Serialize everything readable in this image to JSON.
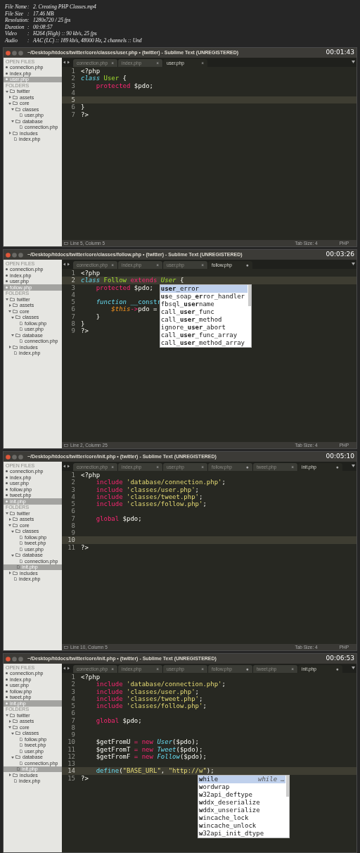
{
  "header": {
    "fields": [
      {
        "label": "File Name",
        "separator": ":",
        "value": "2. Creating PHP Classes.mp4"
      },
      {
        "label": "File Size",
        "separator": ":",
        "value": "17.46 MB"
      },
      {
        "label": "Resolution",
        "separator": ":",
        "value": "1280x720 / 25 fps"
      },
      {
        "label": "Duration",
        "separator": ":",
        "value": "00:08:57"
      },
      {
        "label": "Video",
        "separator": ":",
        "value": "H264 (High) :: 90 kb/s, 25 fps"
      },
      {
        "label": "Audio",
        "separator": ":",
        "value": "AAC (LC) :: 189 kb/s, 48000 Hz, 2 channels :: Und"
      }
    ]
  },
  "frames": [
    {
      "title": "~/Desktop/htdocs/twitter/core/classes/user.php • (twitter) - Sublime Text (UNREGISTERED)",
      "time": "00:01:43",
      "sidebar": {
        "open_files_heading": "OPEN FILES",
        "folders_heading": "FOLDERS",
        "open_files": [
          {
            "name": "connection.php",
            "selected": false
          },
          {
            "name": "index.php",
            "selected": false
          },
          {
            "name": "user.php",
            "selected": true
          }
        ],
        "folders": [
          {
            "name": "twitter",
            "kind": "folder",
            "expanded": true,
            "selected": false,
            "children": [
              {
                "name": "assets",
                "kind": "folder",
                "expanded": false,
                "selected": false
              },
              {
                "name": "core",
                "kind": "folder",
                "expanded": true,
                "selected": false,
                "children": [
                  {
                    "name": "classes",
                    "kind": "folder",
                    "expanded": true,
                    "selected": false,
                    "children": [
                      {
                        "name": "user.php",
                        "kind": "file",
                        "selected": false
                      }
                    ]
                  },
                  {
                    "name": "database",
                    "kind": "folder",
                    "expanded": true,
                    "selected": false,
                    "children": [
                      {
                        "name": "connection.php",
                        "kind": "file",
                        "selected": false
                      }
                    ]
                  }
                ]
              },
              {
                "name": "includes",
                "kind": "folder",
                "expanded": false,
                "selected": false
              },
              {
                "name": "index.php",
                "kind": "file",
                "selected": false
              }
            ]
          }
        ]
      },
      "tabs": [
        {
          "label": "connection.php",
          "close_mark": "×",
          "selected": false
        },
        {
          "label": "index.php",
          "close_mark": "×",
          "selected": false
        },
        {
          "label": "user.php",
          "close_mark": "×",
          "selected": true
        }
      ],
      "lines": [
        {
          "number": "1",
          "current": false,
          "tokens": [
            {
              "kind": "plain",
              "text": "<?php"
            }
          ]
        },
        {
          "number": "2",
          "current": false,
          "tokens": [
            {
              "kind": "storage",
              "text": "class"
            },
            {
              "kind": "class",
              "text": " User"
            },
            {
              "kind": "plain",
              "text": " {"
            }
          ]
        },
        {
          "number": "3",
          "current": false,
          "tokens": [
            {
              "kind": "keyword",
              "text": "    protected"
            },
            {
              "kind": "plain",
              "text": " $pdo;"
            }
          ]
        },
        {
          "number": "4",
          "current": false
        },
        {
          "number": "5",
          "current": true
        },
        {
          "number": "6",
          "current": false,
          "tokens": [
            {
              "kind": "plain",
              "text": "}"
            }
          ]
        },
        {
          "number": "7",
          "current": false,
          "tokens": [
            {
              "kind": "plain",
              "text": "?>"
            }
          ]
        }
      ],
      "status": {
        "position": "Line 5, Column 5",
        "tab_size": "Tab Size: 4",
        "syntax": "PHP"
      }
    },
    {
      "title": "~/Desktop/htdocs/twitter/core/classes/follow.php • (twitter) - Sublime Text (UNREGISTERED)",
      "time": "00:03:26",
      "sidebar": {
        "open_files_heading": "OPEN FILES",
        "folders_heading": "FOLDERS",
        "open_files": [
          {
            "name": "connection.php",
            "selected": false
          },
          {
            "name": "index.php",
            "selected": false
          },
          {
            "name": "user.php",
            "selected": false
          },
          {
            "name": "follow.php",
            "selected": true
          }
        ],
        "folders": [
          {
            "name": "twitter",
            "kind": "folder",
            "expanded": true,
            "selected": false,
            "children": [
              {
                "name": "assets",
                "kind": "folder",
                "expanded": false,
                "selected": false
              },
              {
                "name": "core",
                "kind": "folder",
                "expanded": true,
                "selected": false,
                "children": [
                  {
                    "name": "classes",
                    "kind": "folder",
                    "expanded": true,
                    "selected": false,
                    "children": [
                      {
                        "name": "follow.php",
                        "kind": "file",
                        "selected": false
                      },
                      {
                        "name": "user.php",
                        "kind": "file",
                        "selected": false
                      }
                    ]
                  },
                  {
                    "name": "database",
                    "kind": "folder",
                    "expanded": true,
                    "selected": false,
                    "children": [
                      {
                        "name": "connection.php",
                        "kind": "file",
                        "selected": false
                      }
                    ]
                  }
                ]
              },
              {
                "name": "includes",
                "kind": "folder",
                "expanded": false,
                "selected": false
              },
              {
                "name": "index.php",
                "kind": "file",
                "selected": false
              }
            ]
          }
        ]
      },
      "tabs": [
        {
          "label": "connection.php",
          "close_mark": "×",
          "selected": false
        },
        {
          "label": "index.php",
          "close_mark": "×",
          "selected": false
        },
        {
          "label": "user.php",
          "close_mark": "×",
          "selected": false
        },
        {
          "label": "follow.php",
          "close_mark": "●",
          "selected": true
        }
      ],
      "lines": [
        {
          "number": "1",
          "current": false,
          "tokens": [
            {
              "kind": "plain",
              "text": "<?php"
            }
          ]
        },
        {
          "number": "2",
          "current": true,
          "tokens": [
            {
              "kind": "storage",
              "text": "class"
            },
            {
              "kind": "class",
              "text": " Follow"
            },
            {
              "kind": "keyword",
              "text": " extends "
            },
            {
              "kind": "inherited",
              "text": "User",
              "completing": true
            },
            {
              "kind": "plain",
              "text": " {"
            }
          ]
        },
        {
          "number": "3",
          "current": false,
          "tokens": [
            {
              "kind": "keyword",
              "text": "    protected"
            },
            {
              "kind": "plain",
              "text": " $pdo;"
            }
          ]
        },
        {
          "number": "4",
          "current": false
        },
        {
          "number": "5",
          "current": false,
          "tokens": [
            {
              "kind": "storage",
              "text": "    function"
            },
            {
              "kind": "func",
              "text": " __constr"
            }
          ]
        },
        {
          "number": "6",
          "current": false,
          "tokens": [
            {
              "kind": "variable",
              "text": "        $this"
            },
            {
              "kind": "keyword",
              "text": "->"
            },
            {
              "kind": "plain",
              "text": "pdo ="
            }
          ]
        },
        {
          "number": "7",
          "current": false,
          "tokens": [
            {
              "kind": "plain",
              "text": "    }"
            }
          ]
        },
        {
          "number": "8",
          "current": false,
          "tokens": [
            {
              "kind": "plain",
              "text": "}"
            }
          ]
        },
        {
          "number": "9",
          "current": false,
          "tokens": [
            {
              "kind": "plain",
              "text": "?>"
            }
          ]
        }
      ],
      "autocomplete": {
        "items": [
          {
            "text": "**user**_error",
            "selected": true
          },
          {
            "text": "**us**e_soap_**er**ror_handler",
            "selected": false
          },
          {
            "text": "fbsql_**user**name",
            "selected": false
          },
          {
            "text": "call_**user**_func",
            "selected": false
          },
          {
            "text": "call_**user**_method",
            "selected": false
          },
          {
            "text": "ignore_**user**_abort",
            "selected": false
          },
          {
            "text": "call_**user**_func_array",
            "selected": false
          },
          {
            "text": "call_**user**_method_array",
            "selected": false
          }
        ]
      },
      "status": {
        "position": "Line 2, Column 25",
        "tab_size": "Tab Size: 4",
        "syntax": "PHP"
      }
    },
    {
      "title": "~/Desktop/htdocs/twitter/core/init.php • (twitter) - Sublime Text (UNREGISTERED)",
      "time": "00:05:10",
      "sidebar": {
        "open_files_heading": "OPEN FILES",
        "folders_heading": "FOLDERS",
        "open_files": [
          {
            "name": "connection.php",
            "selected": false
          },
          {
            "name": "index.php",
            "selected": false
          },
          {
            "name": "user.php",
            "selected": false
          },
          {
            "name": "follow.php",
            "selected": false
          },
          {
            "name": "tweet.php",
            "selected": false
          },
          {
            "name": "init.php",
            "selected": true
          }
        ],
        "folders": [
          {
            "name": "twitter",
            "kind": "folder",
            "expanded": true,
            "selected": false,
            "children": [
              {
                "name": "assets",
                "kind": "folder",
                "expanded": false,
                "selected": false
              },
              {
                "name": "core",
                "kind": "folder",
                "expanded": true,
                "selected": false,
                "children": [
                  {
                    "name": "classes",
                    "kind": "folder",
                    "expanded": true,
                    "selected": false,
                    "children": [
                      {
                        "name": "follow.php",
                        "kind": "file",
                        "selected": false
                      },
                      {
                        "name": "tweet.php",
                        "kind": "file",
                        "selected": false
                      },
                      {
                        "name": "user.php",
                        "kind": "file",
                        "selected": false
                      }
                    ]
                  },
                  {
                    "name": "database",
                    "kind": "folder",
                    "expanded": true,
                    "selected": false,
                    "children": [
                      {
                        "name": "connection.php",
                        "kind": "file",
                        "selected": false
                      }
                    ]
                  },
                  {
                    "name": "init.php",
                    "kind": "file",
                    "selected": true
                  }
                ]
              },
              {
                "name": "includes",
                "kind": "folder",
                "expanded": false,
                "selected": false
              },
              {
                "name": "index.php",
                "kind": "file",
                "selected": false
              }
            ]
          }
        ]
      },
      "tabs": [
        {
          "label": "connection.php",
          "close_mark": "×",
          "selected": false
        },
        {
          "label": "index.php",
          "close_mark": "×",
          "selected": false
        },
        {
          "label": "user.php",
          "close_mark": "×",
          "selected": false
        },
        {
          "label": "follow.php",
          "close_mark": "●",
          "selected": false
        },
        {
          "label": "tweet.php",
          "close_mark": "×",
          "selected": false
        },
        {
          "label": "init.php",
          "close_mark": "●",
          "selected": true
        }
      ],
      "lines": [
        {
          "number": "1",
          "current": false,
          "tokens": [
            {
              "kind": "plain",
              "text": "<?php"
            }
          ]
        },
        {
          "number": "2",
          "current": false,
          "tokens": [
            {
              "kind": "keyword",
              "text": "    include"
            },
            {
              "kind": "string",
              "text": " 'database/connection.php'"
            },
            {
              "kind": "plain",
              "text": ";"
            }
          ]
        },
        {
          "number": "3",
          "current": false,
          "tokens": [
            {
              "kind": "keyword",
              "text": "    include"
            },
            {
              "kind": "string",
              "text": " 'classes/user.php'"
            },
            {
              "kind": "plain",
              "text": ";"
            }
          ]
        },
        {
          "number": "4",
          "current": false,
          "tokens": [
            {
              "kind": "keyword",
              "text": "    include"
            },
            {
              "kind": "string",
              "text": " 'classes/tweet.php'"
            },
            {
              "kind": "plain",
              "text": ";"
            }
          ]
        },
        {
          "number": "5",
          "current": false,
          "tokens": [
            {
              "kind": "keyword",
              "text": "    include"
            },
            {
              "kind": "string",
              "text": " 'classes/follow.php'"
            },
            {
              "kind": "plain",
              "text": ";"
            }
          ]
        },
        {
          "number": "6",
          "current": false
        },
        {
          "number": "7",
          "current": false,
          "tokens": [
            {
              "kind": "keyword",
              "text": "    global"
            },
            {
              "kind": "plain",
              "text": " $pdo;"
            }
          ]
        },
        {
          "number": "8",
          "current": false
        },
        {
          "number": "9",
          "current": false
        },
        {
          "number": "10",
          "current": true
        },
        {
          "number": "11",
          "current": false,
          "tokens": [
            {
              "kind": "plain",
              "text": "?>"
            }
          ]
        }
      ],
      "status": {
        "position": "Line 10, Column 5",
        "tab_size": "Tab Size: 4",
        "syntax": "PHP"
      }
    },
    {
      "title": "~/Desktop/htdocs/twitter/core/init.php • (twitter) - Sublime Text (UNREGISTERED)",
      "time": "00:06:53",
      "sidebar": {
        "open_files_heading": "OPEN FILES",
        "folders_heading": "FOLDERS",
        "open_files": [
          {
            "name": "connection.php",
            "selected": false
          },
          {
            "name": "index.php",
            "selected": false
          },
          {
            "name": "user.php",
            "selected": false
          },
          {
            "name": "follow.php",
            "selected": false
          },
          {
            "name": "tweet.php",
            "selected": false
          },
          {
            "name": "init.php",
            "selected": true
          }
        ],
        "folders": [
          {
            "name": "twitter",
            "kind": "folder",
            "expanded": true,
            "selected": false,
            "children": [
              {
                "name": "assets",
                "kind": "folder",
                "expanded": false,
                "selected": false
              },
              {
                "name": "core",
                "kind": "folder",
                "expanded": true,
                "selected": false,
                "children": [
                  {
                    "name": "classes",
                    "kind": "folder",
                    "expanded": true,
                    "selected": false,
                    "children": [
                      {
                        "name": "follow.php",
                        "kind": "file",
                        "selected": false
                      },
                      {
                        "name": "tweet.php",
                        "kind": "file",
                        "selected": false
                      },
                      {
                        "name": "user.php",
                        "kind": "file",
                        "selected": false
                      }
                    ]
                  },
                  {
                    "name": "database",
                    "kind": "folder",
                    "expanded": true,
                    "selected": false,
                    "children": [
                      {
                        "name": "connection.php",
                        "kind": "file",
                        "selected": false
                      }
                    ]
                  },
                  {
                    "name": "init.php",
                    "kind": "file",
                    "selected": true
                  }
                ]
              },
              {
                "name": "includes",
                "kind": "folder",
                "expanded": false,
                "selected": false
              },
              {
                "name": "index.php",
                "kind": "file",
                "selected": false
              }
            ]
          }
        ]
      },
      "tabs": [
        {
          "label": "connection.php",
          "close_mark": "×",
          "selected": false
        },
        {
          "label": "index.php",
          "close_mark": "×",
          "selected": false
        },
        {
          "label": "user.php",
          "close_mark": "×",
          "selected": false
        },
        {
          "label": "follow.php",
          "close_mark": "●",
          "selected": false
        },
        {
          "label": "tweet.php",
          "close_mark": "×",
          "selected": false
        },
        {
          "label": "init.php",
          "close_mark": "●",
          "selected": true
        }
      ],
      "lines": [
        {
          "number": "1",
          "current": false,
          "tokens": [
            {
              "kind": "plain",
              "text": "<?php"
            }
          ]
        },
        {
          "number": "2",
          "current": false,
          "tokens": [
            {
              "kind": "keyword",
              "text": "    include"
            },
            {
              "kind": "string",
              "text": " 'database/connection.php'"
            },
            {
              "kind": "plain",
              "text": ";"
            }
          ]
        },
        {
          "number": "3",
          "current": false,
          "tokens": [
            {
              "kind": "keyword",
              "text": "    include"
            },
            {
              "kind": "string",
              "text": " 'classes/user.php'"
            },
            {
              "kind": "plain",
              "text": ";"
            }
          ]
        },
        {
          "number": "4",
          "current": false,
          "tokens": [
            {
              "kind": "keyword",
              "text": "    include"
            },
            {
              "kind": "string",
              "text": " 'classes/tweet.php'"
            },
            {
              "kind": "plain",
              "text": ";"
            }
          ]
        },
        {
          "number": "5",
          "current": false,
          "tokens": [
            {
              "kind": "keyword",
              "text": "    include"
            },
            {
              "kind": "string",
              "text": " 'classes/follow.php'"
            },
            {
              "kind": "plain",
              "text": ";"
            }
          ]
        },
        {
          "number": "6",
          "current": false
        },
        {
          "number": "7",
          "current": false,
          "tokens": [
            {
              "kind": "keyword",
              "text": "    global"
            },
            {
              "kind": "plain",
              "text": " $pdo;"
            }
          ]
        },
        {
          "number": "8",
          "current": false
        },
        {
          "number": "9",
          "current": false
        },
        {
          "number": "10",
          "current": false,
          "tokens": [
            {
              "kind": "plain",
              "text": "    $getFromU "
            },
            {
              "kind": "keyword",
              "text": "="
            },
            {
              "kind": "keyword",
              "text": " new"
            },
            {
              "kind": "storage",
              "text": " User"
            },
            {
              "kind": "plain",
              "text": "($pdo);"
            }
          ]
        },
        {
          "number": "11",
          "current": false,
          "tokens": [
            {
              "kind": "plain",
              "text": "    $getFromT "
            },
            {
              "kind": "keyword",
              "text": "="
            },
            {
              "kind": "keyword",
              "text": " new"
            },
            {
              "kind": "storage",
              "text": " Tweet"
            },
            {
              "kind": "plain",
              "text": "($pdo);"
            }
          ]
        },
        {
          "number": "12",
          "current": false,
          "tokens": [
            {
              "kind": "plain",
              "text": "    $getFromF "
            },
            {
              "kind": "keyword",
              "text": "="
            },
            {
              "kind": "keyword",
              "text": " new"
            },
            {
              "kind": "storage",
              "text": " Follow"
            },
            {
              "kind": "plain",
              "text": "($pdo);"
            }
          ]
        },
        {
          "number": "13",
          "current": false
        },
        {
          "number": "14",
          "current": true,
          "tokens": [
            {
              "kind": "func",
              "text": "    define"
            },
            {
              "kind": "plain",
              "text": "("
            },
            {
              "kind": "string",
              "text": "\"BASE_URL\""
            },
            {
              "kind": "plain",
              "text": ", "
            },
            {
              "kind": "string",
              "text": "\"http://"
            },
            {
              "kind": "string",
              "text": "w",
              "completing": true
            },
            {
              "kind": "string",
              "text": "\""
            },
            {
              "kind": "plain",
              "text": ");"
            }
          ]
        },
        {
          "number": "15",
          "current": false,
          "tokens": [
            {
              "kind": "plain",
              "text": "?>"
            }
          ]
        }
      ],
      "autocomplete": {
        "items": [
          {
            "text": "**w**hile",
            "hint": "while …",
            "selected": true
          },
          {
            "text": "**w**ordwrap",
            "selected": false
          },
          {
            "text": "**w**32api_deftype",
            "selected": false
          },
          {
            "text": "**w**ddx_deserialize",
            "selected": false
          },
          {
            "text": "**w**ddx_unserialize",
            "selected": false
          },
          {
            "text": "**w**incache_lock",
            "selected": false
          },
          {
            "text": "**w**incache_unlock",
            "selected": false
          },
          {
            "text": "**w**32api_init_dtype",
            "selected": false
          }
        ]
      }
    }
  ]
}
